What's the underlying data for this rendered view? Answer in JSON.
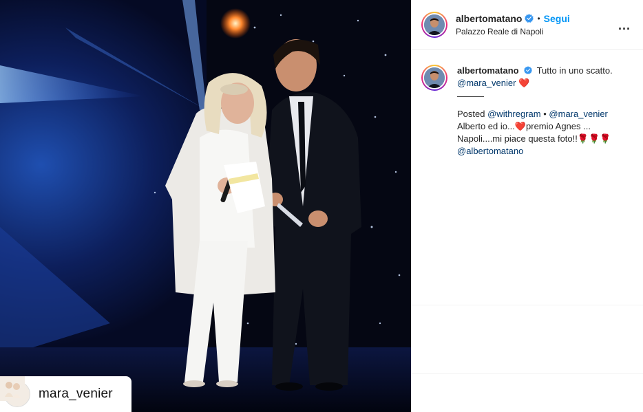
{
  "photo": {
    "repost_username": "mara_venier"
  },
  "header": {
    "username": "albertomatano",
    "separator": "•",
    "follow_label": "Segui",
    "location": "Palazzo Reale di Napoli",
    "more_label": "..."
  },
  "caption": {
    "username": "albertomatano",
    "text": "Tutto in uno scatto.",
    "mention": "@mara_venier",
    "heart": "❤️",
    "divider": "———",
    "posted_label": "Posted",
    "withregram": "@withregram",
    "bullet": "•",
    "mention2": "@mara_venier",
    "line2_a": "Alberto ed io...",
    "line2_b": "premio Agnes ...",
    "line3": "Napoli....mi piace questa foto!!",
    "roses": "🌹🌹🌹",
    "mention3": "@albertomatano"
  },
  "colors": {
    "link": "#0095f6",
    "mention": "#00376b",
    "stage_blue": "#1f4fb0"
  }
}
